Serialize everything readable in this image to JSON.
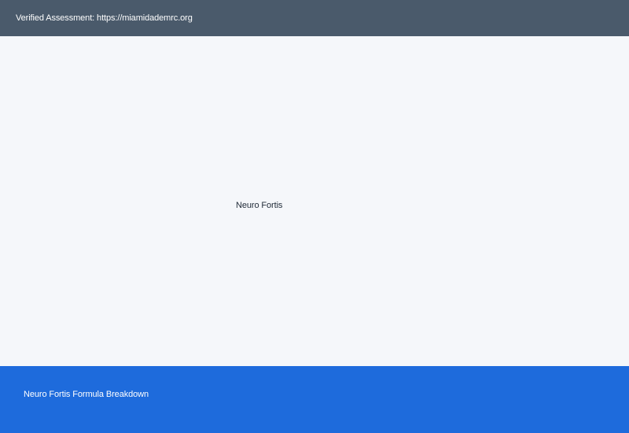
{
  "header": {
    "text": "Verified Assessment: https://miamidademrc.org"
  },
  "main": {
    "label": "Neuro Fortis"
  },
  "footer": {
    "link_text": "Neuro Fortis Formula Breakdown"
  },
  "colors": {
    "header_bg": "#4a5a6b",
    "content_bg": "#f5f7fa",
    "footer_bg": "#1e6bdc"
  }
}
